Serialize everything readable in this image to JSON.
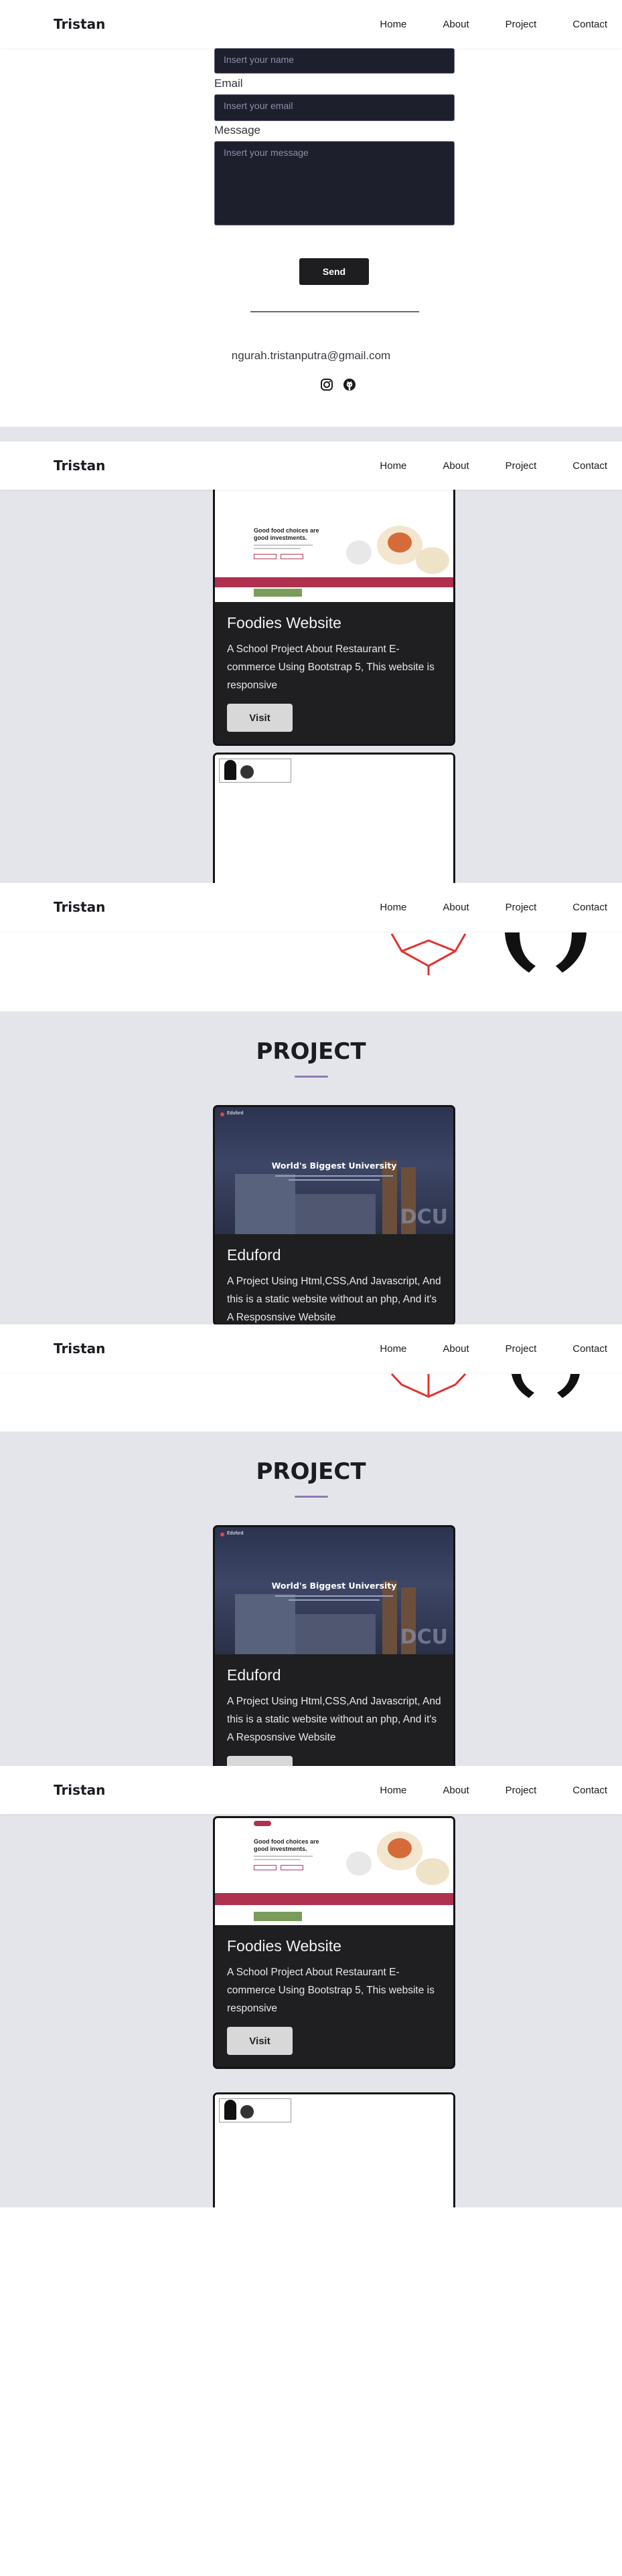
{
  "nav": {
    "brand": "Tristan",
    "links": [
      "Home",
      "About",
      "Project",
      "Contact"
    ]
  },
  "contact": {
    "name_placeholder": "Insert your name",
    "email_label": "Email",
    "email_placeholder": "Insert your email",
    "message_label": "Message",
    "message_placeholder": "Insert your message",
    "send_label": "Send",
    "email_address": "ngurah.tristanputra@gmail.com",
    "social_icons": [
      "instagram-icon",
      "github-icon"
    ]
  },
  "project": {
    "section_title": "PROJECT",
    "accent_color": "#8e7bb5",
    "cards": [
      {
        "title": "Eduford",
        "description": "A Project Using Html,CSS,And Javascript, And this is a static website without an php, And it's A Resposnsive Website",
        "thumb": {
          "logo": "Eduford",
          "heading": "World's Biggest University",
          "sign": "DCU"
        }
      },
      {
        "title": "Foodies Website",
        "description": "A School Project About Restaurant E-commerce Using Bootstrap 5, This website is responsive",
        "visit_label": "Visit",
        "thumb": {
          "heading": "Good food choices are good investments."
        }
      }
    ]
  },
  "colors": {
    "nav_bg": "#ffffff",
    "section_bg": "#e4e5ea",
    "card_bg": "#1f1f22",
    "field_bg": "#1d1f2d",
    "send_bg": "#1e1e21",
    "food_bar": "#b0304f"
  }
}
